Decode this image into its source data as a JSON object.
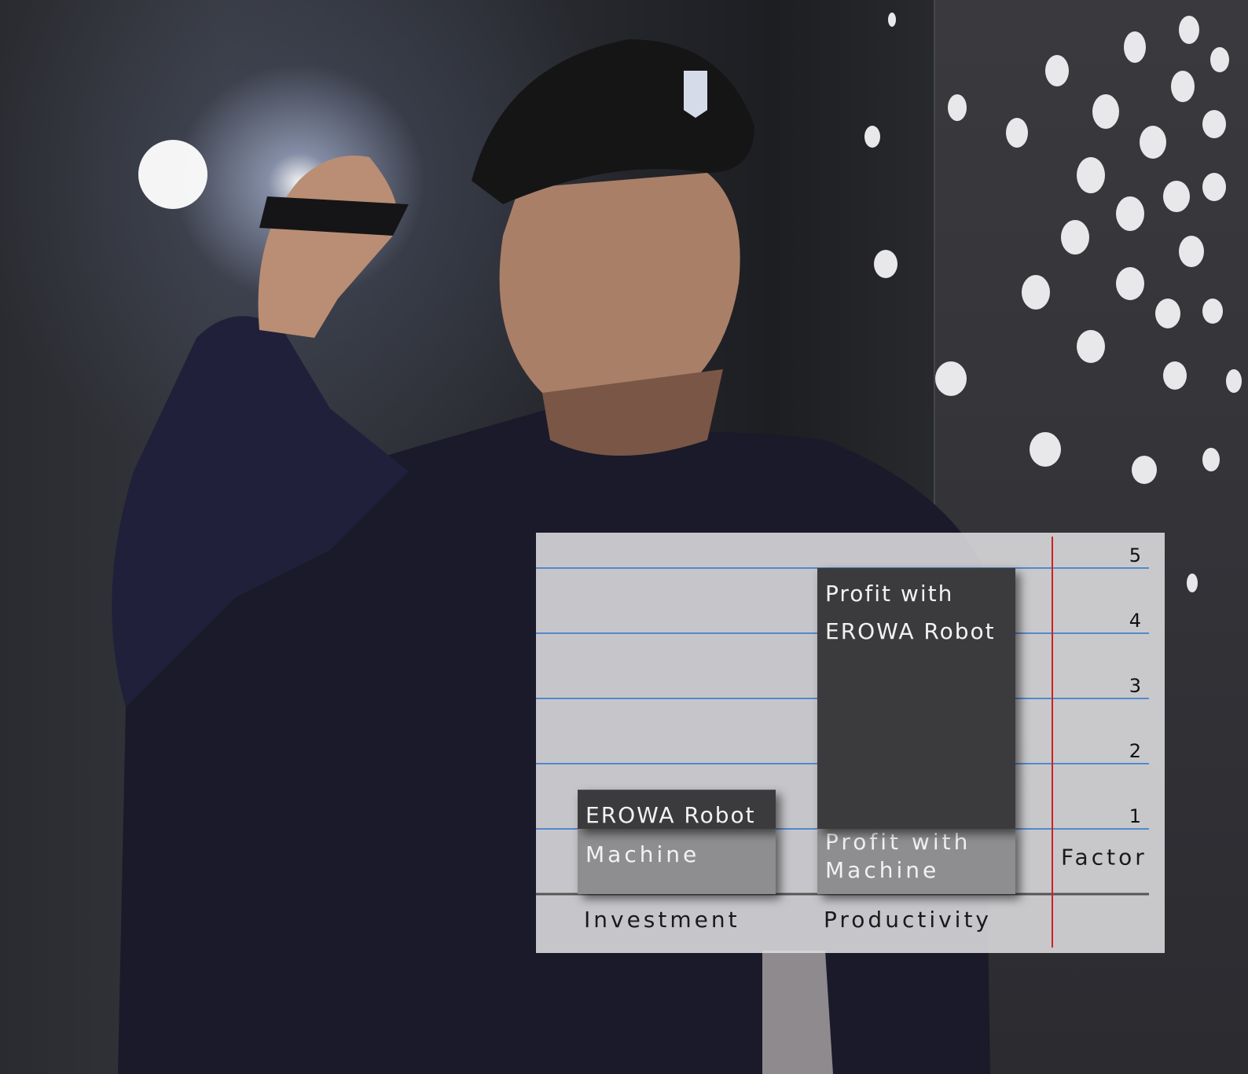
{
  "chart_data": {
    "type": "bar",
    "ylim": [
      0,
      5
    ],
    "y_ticks": [
      "1",
      "2",
      "3",
      "4",
      "5"
    ],
    "factor_label": "Factor",
    "categories": [
      "Investment",
      "Productivity"
    ],
    "stacks": [
      {
        "category": "Investment",
        "segments": [
          {
            "label": "Machine",
            "value": 1.0,
            "color": "#8e8e90",
            "text": "light"
          },
          {
            "label": "EROWA Robot",
            "value": 0.6,
            "color": "#3b3b3e",
            "text": "light"
          }
        ]
      },
      {
        "category": "Productivity",
        "segments": [
          {
            "label": "Profit with Machine",
            "value": 1.0,
            "color": "#8e8e90",
            "text": "light"
          },
          {
            "label": "Profit with EROWA Robot",
            "value": 4.0,
            "color": "#3b3b3e",
            "text": "light"
          }
        ]
      }
    ],
    "colors": {
      "gridline": "#2e74c9",
      "baseline": "#555555",
      "marker": "#cc2222"
    }
  }
}
